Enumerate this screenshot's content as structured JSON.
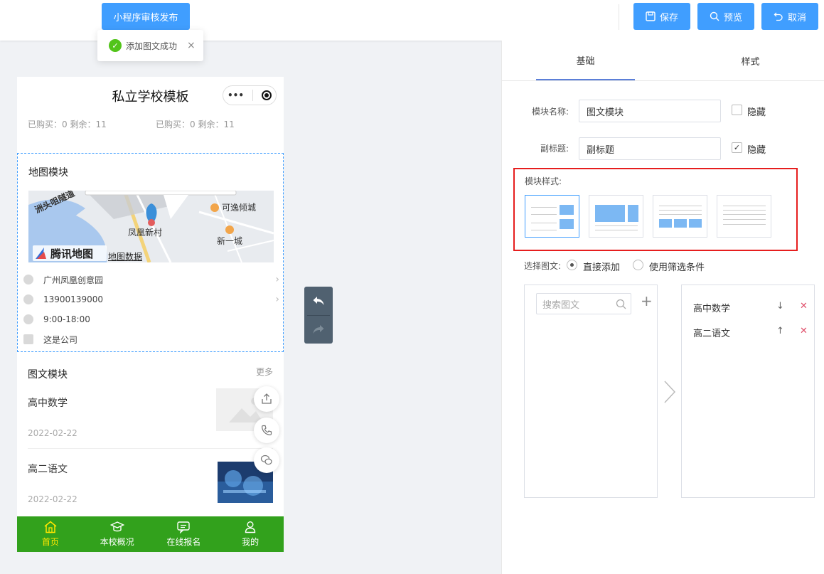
{
  "topbar": {
    "publish_label": "小程序审核发布",
    "save_label": "保存",
    "preview_label": "预览",
    "cancel_label": "取消"
  },
  "toast": {
    "message": "添加图文成功"
  },
  "phone": {
    "title": "私立学校模板",
    "capsule_more": "•••",
    "quota_left": "已购买：0 剩余：11",
    "quota_right": "已购买：0 剩余：11",
    "map_module": {
      "title": "地图模块",
      "map_labels": {
        "road": "洲头咀隧道",
        "poi_1": "可逸倾城",
        "poi_2": "凤凰新村",
        "poi_3": "新一城",
        "logo": "腾讯地图",
        "data": "地图数据"
      },
      "address": "广州凤凰创意园",
      "phone": "13900139000",
      "hours": "9:00-18:00",
      "note": "这是公司"
    },
    "article_module": {
      "title": "图文模块",
      "more": "更多",
      "items": [
        {
          "title": "高中数学",
          "date": "2022-02-22"
        },
        {
          "title": "高二语文",
          "date": "2022-02-22"
        }
      ]
    },
    "tabbar": [
      {
        "label": "首页",
        "icon": "home-icon"
      },
      {
        "label": "本校概况",
        "icon": "graduation-cap-icon"
      },
      {
        "label": "在线报名",
        "icon": "chat-icon"
      },
      {
        "label": "我的",
        "icon": "user-icon"
      }
    ]
  },
  "panel": {
    "tabs": [
      "基础",
      "样式"
    ],
    "module_name_label": "模块名称:",
    "module_name_value": "图文模块",
    "hide_label_1": "隐藏",
    "hide_1_checked": false,
    "subtitle_label": "副标题:",
    "subtitle_value": "副标题",
    "hide_label_2": "隐藏",
    "hide_2_checked": true,
    "style_label": "模块样式:",
    "select_label": "选择图文:",
    "radio_direct": "直接添加",
    "radio_filter": "使用筛选条件",
    "search_placeholder": "搜索图文",
    "selected": [
      {
        "title": "高中数学",
        "move": "↓",
        "remove": "✕"
      },
      {
        "title": "高二语文",
        "move": "↑",
        "remove": "✕"
      }
    ]
  },
  "colors": {
    "primary": "#409eff",
    "tabbar": "#32a11c",
    "tab_active": "#ffe600",
    "highlight_border": "#e61e1e"
  }
}
